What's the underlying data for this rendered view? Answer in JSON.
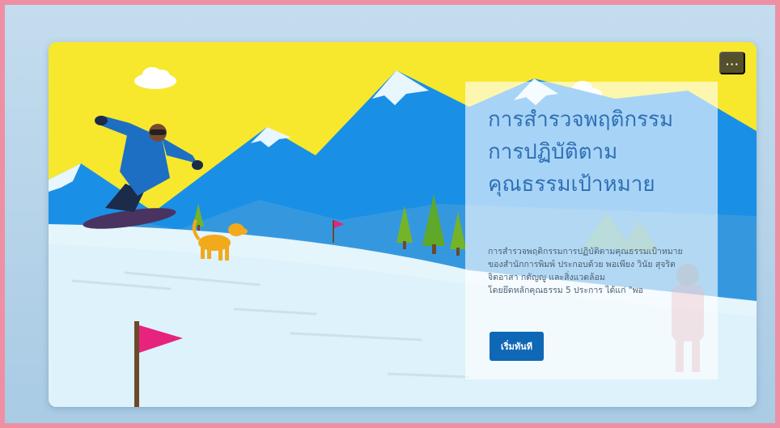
{
  "card": {
    "more_button_label": "···",
    "title": "การสำรวจพฤติกรรมการปฏิบัติตามคุณธรรมเป้าหมาย",
    "description": "การสำรวจพฤติกรรมการปฏิบัติตามคุณธรรมเป้าหมายของสำนักการพิมพ์ ประกอบด้วย พอเพียง วินัย สุจริต จิตอาสา กตัญญู และสิ่งแวดล้อม\nโดยยึดหลักคุณธรรม 5 ประการ ได้แก่ \"พอ",
    "start_button_label": "เริ่มทันที"
  },
  "colors": {
    "frame_border": "#ef8fa4",
    "sky": "#f7e82d",
    "mountain": "#1a8fe6",
    "snow": "#e4f5fb",
    "button": "#0f68b6",
    "title": "#2f6fb6"
  }
}
